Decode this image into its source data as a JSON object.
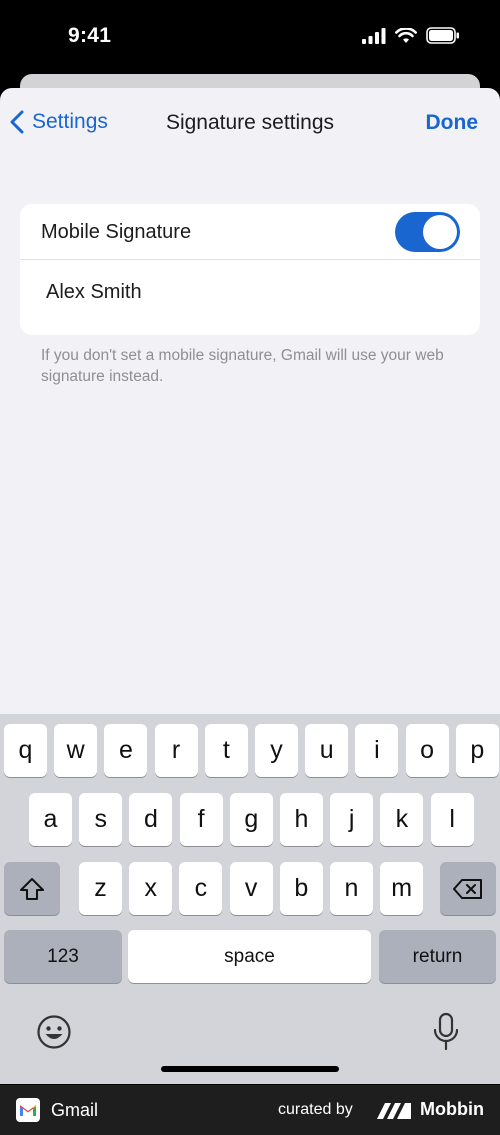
{
  "status_bar": {
    "time": "9:41"
  },
  "nav": {
    "back_label": "Settings",
    "title": "Signature settings",
    "done_label": "Done"
  },
  "signature": {
    "toggle_label": "Mobile Signature",
    "toggle_on": true,
    "value": "Alex Smith",
    "hint": "If you don't set a mobile signature, Gmail will use your web signature instead."
  },
  "keyboard": {
    "row1": [
      "q",
      "w",
      "e",
      "r",
      "t",
      "y",
      "u",
      "i",
      "o",
      "p"
    ],
    "row2": [
      "a",
      "s",
      "d",
      "f",
      "g",
      "h",
      "j",
      "k",
      "l"
    ],
    "row3": [
      "z",
      "x",
      "c",
      "v",
      "b",
      "n",
      "m"
    ],
    "numbers_label": "123",
    "space_label": "space",
    "return_label": "return"
  },
  "footer": {
    "app_name": "Gmail",
    "curated_by": "curated by",
    "brand": "Mobbin"
  },
  "colors": {
    "accent": "#1a66d1",
    "sheet_bg": "#f2f2f6",
    "keyboard_bg": "#d2d4da"
  }
}
